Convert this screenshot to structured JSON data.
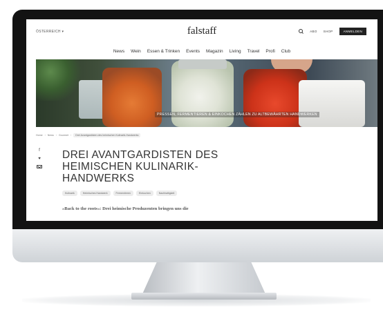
{
  "header": {
    "country": "ÖSTERREICH ▾",
    "logo": "falstaff",
    "links": [
      "ABO",
      "SHOP"
    ],
    "login": "ANMELDEN"
  },
  "nav": [
    "News",
    "Wein",
    "Essen & Trinken",
    "Events",
    "Magazin",
    "Living",
    "Travel",
    "Profi",
    "Club"
  ],
  "hero": {
    "caption": "PRESSEN, FERMENTIEREN & EINKOCHEN ZÄHLEN ZU ALTBEWÄHRTEN HANDWERKEN"
  },
  "breadcrumb": [
    "Home",
    "News",
    "Gourmet",
    "Drei Avantgardisten des heimischen Kulinarik-Handwerks"
  ],
  "share": {
    "facebook": "f",
    "twitter": "♥"
  },
  "article": {
    "headline": "DREI AVANTGARDISTEN DES HEIMISCHEN KULINARIK-HANDWERKS",
    "tags": [
      "Kulinarik",
      "Heimisches Handwerk",
      "Fermentieren",
      "Einkochen",
      "Nachhaltigkeit"
    ],
    "lead": "»Back to the roots«: Drei heimische Produzenten bringen uns die"
  }
}
